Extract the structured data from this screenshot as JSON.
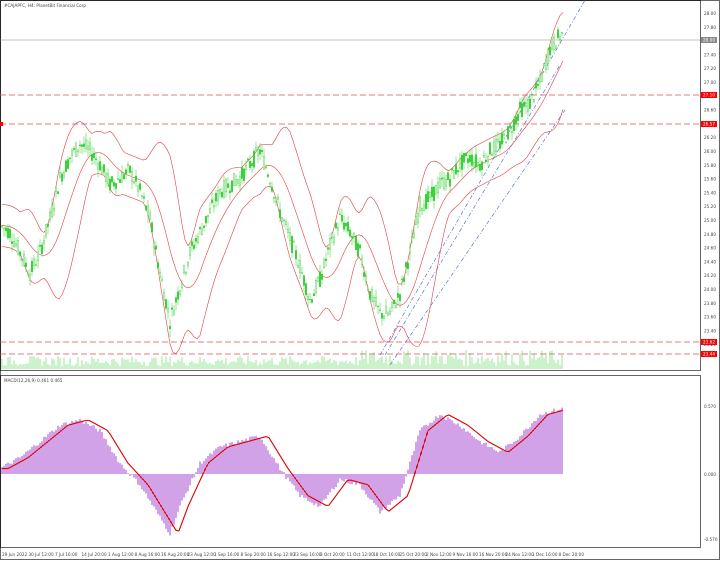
{
  "window": {
    "title": "#CAJAPFC, H4: PlanetBit Financial Corp",
    "indicator_label": "MACD(12,26,9) 0.461 0.465"
  },
  "colors": {
    "background": "#ffffff",
    "candle": "#32cd32",
    "bands": "#e04040",
    "hline": "#e05050",
    "channel": "#3a5fcd",
    "volume": "#32cd32",
    "macd_hist": "#9932cc",
    "macd_signal": "#e00000",
    "bid_line": "#999999",
    "price_tag_red": "#ff0000",
    "price_tag_grey": "#888888"
  },
  "price_tags": {
    "current": "28.00",
    "level1": "27.10",
    "level2": "26.57",
    "support1": "23.62",
    "support2": "23.44"
  },
  "price_axis": [
    "28.00",
    "27.80",
    "27.60",
    "27.40",
    "27.20",
    "27.00",
    "26.80",
    "26.60",
    "26.40",
    "26.20",
    "26.00",
    "25.80",
    "25.60",
    "25.40",
    "25.20",
    "25.00",
    "24.80",
    "24.60",
    "24.40",
    "24.20",
    "24.00",
    "23.80",
    "23.60",
    "23.40",
    "23.20"
  ],
  "macd_axis": [
    "0.570",
    "0.000",
    "-0.570"
  ],
  "time_axis": [
    "29 Jun 2022",
    "30 Jul 12:00",
    "7 Jul 16:00",
    "14 Jul 20:00",
    "1 Aug 12:00",
    "8 Aug 16:00",
    "16 Aug 20:00",
    "23 Aug 12:00",
    "1 Sep 16:00",
    "8 Sep 20:00",
    "16 Sep 12:00",
    "23 Sep 16:00",
    "3 Oct 20:00",
    "11 Oct 12:00",
    "18 Oct 16:00",
    "25 Oct 20:00",
    "2 Nov 12:00",
    "9 Nov 16:00",
    "16 Nov 20:00",
    "24 Nov 12:00",
    "1 Dec 16:00",
    "8 Dec 20:00"
  ],
  "chart_data": {
    "type": "candlestick",
    "instrument": "#CAJAPFC",
    "timeframe": "H4",
    "close_path": [
      [
        0,
        25.2
      ],
      [
        10,
        25.1
      ],
      [
        20,
        24.8
      ],
      [
        30,
        24.5
      ],
      [
        40,
        24.8
      ],
      [
        50,
        25.3
      ],
      [
        60,
        25.9
      ],
      [
        70,
        26.2
      ],
      [
        80,
        26.4
      ],
      [
        90,
        26.3
      ],
      [
        100,
        26.1
      ],
      [
        110,
        25.8
      ],
      [
        120,
        25.9
      ],
      [
        130,
        26.0
      ],
      [
        140,
        25.7
      ],
      [
        150,
        25.3
      ],
      [
        160,
        24.5
      ],
      [
        170,
        23.8
      ],
      [
        180,
        24.3
      ],
      [
        190,
        24.8
      ],
      [
        200,
        25.1
      ],
      [
        210,
        25.4
      ],
      [
        220,
        25.7
      ],
      [
        230,
        25.8
      ],
      [
        240,
        25.9
      ],
      [
        250,
        26.1
      ],
      [
        260,
        26.3
      ],
      [
        270,
        25.9
      ],
      [
        280,
        25.4
      ],
      [
        290,
        25.0
      ],
      [
        300,
        24.6
      ],
      [
        310,
        24.1
      ],
      [
        320,
        24.4
      ],
      [
        330,
        24.9
      ],
      [
        340,
        25.3
      ],
      [
        350,
        25.1
      ],
      [
        360,
        24.8
      ],
      [
        370,
        24.2
      ],
      [
        380,
        23.9
      ],
      [
        390,
        23.9
      ],
      [
        400,
        24.2
      ],
      [
        410,
        24.8
      ],
      [
        420,
        25.5
      ],
      [
        430,
        25.6
      ],
      [
        440,
        25.8
      ],
      [
        450,
        25.9
      ],
      [
        460,
        26.1
      ],
      [
        470,
        26.2
      ],
      [
        480,
        26.1
      ],
      [
        490,
        26.3
      ],
      [
        500,
        26.4
      ],
      [
        510,
        26.6
      ],
      [
        520,
        26.9
      ],
      [
        530,
        27.0
      ],
      [
        540,
        27.3
      ],
      [
        550,
        27.8
      ],
      [
        560,
        28.0
      ]
    ],
    "macd_path": [
      [
        0,
        0.05
      ],
      [
        20,
        0.15
      ],
      [
        40,
        0.3
      ],
      [
        60,
        0.45
      ],
      [
        80,
        0.5
      ],
      [
        100,
        0.4
      ],
      [
        120,
        0.1
      ],
      [
        140,
        -0.1
      ],
      [
        160,
        -0.4
      ],
      [
        170,
        -0.55
      ],
      [
        180,
        -0.3
      ],
      [
        200,
        0.1
      ],
      [
        220,
        0.25
      ],
      [
        240,
        0.3
      ],
      [
        260,
        0.35
      ],
      [
        280,
        0.05
      ],
      [
        300,
        -0.2
      ],
      [
        320,
        -0.3
      ],
      [
        340,
        -0.05
      ],
      [
        360,
        -0.1
      ],
      [
        380,
        -0.35
      ],
      [
        400,
        -0.2
      ],
      [
        420,
        0.4
      ],
      [
        440,
        0.55
      ],
      [
        460,
        0.45
      ],
      [
        480,
        0.3
      ],
      [
        500,
        0.2
      ],
      [
        520,
        0.35
      ],
      [
        540,
        0.55
      ],
      [
        560,
        0.6
      ]
    ]
  }
}
